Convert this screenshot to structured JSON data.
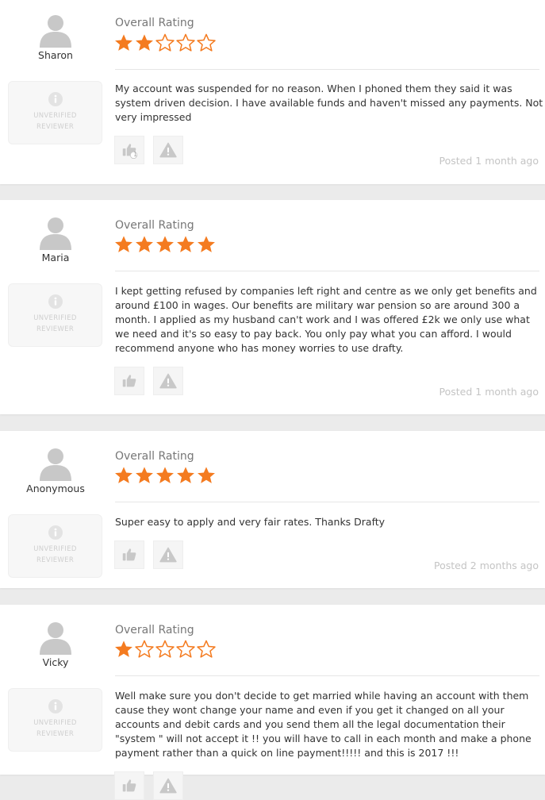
{
  "colors": {
    "star_filled": "#f47b20",
    "star_empty": "#f47b20",
    "avatar": "#c8c8c8",
    "muted_text": "#c4c4c4",
    "page_background": "#ebebeb"
  },
  "icons": {
    "avatar": "person-silhouette-icon",
    "unverified": "info-circle-icon",
    "helpful": "thumbs-up-icon",
    "report": "warning-triangle-icon",
    "star": "star-icon"
  },
  "reviews": [
    {
      "reviewer": "Sharon",
      "badge_text": "UNVERIFIED\nREVIEWER",
      "rating_label": "Overall Rating",
      "rating": 2,
      "max_rating": 5,
      "text": "My account was suspended for no reason. When I phoned them they said it was system driven decision. I have available funds and haven't missed any payments. Not very impressed",
      "helpful_count": "1",
      "posted": "Posted 1 month ago"
    },
    {
      "reviewer": "Maria",
      "badge_text": "UNVERIFIED\nREVIEWER",
      "rating_label": "Overall Rating",
      "rating": 5,
      "max_rating": 5,
      "text": "I kept getting refused by companies left right and centre as we only get benefits and around £100 in wages. Our benefits are military war pension so are around 300 a month. I applied as my husband can't work and I was offered £2k we only use what we need and it's so easy to pay back. You only pay what you can afford. I would recommend anyone who has money worries to use drafty.",
      "helpful_count": "",
      "posted": "Posted 1 month ago"
    },
    {
      "reviewer": "Anonymous",
      "badge_text": "UNVERIFIED\nREVIEWER",
      "rating_label": "Overall Rating",
      "rating": 5,
      "max_rating": 5,
      "text": "Super easy to apply and very fair rates. Thanks Drafty",
      "helpful_count": "",
      "posted": "Posted 2 months ago"
    },
    {
      "reviewer": "Vicky",
      "badge_text": "UNVERIFIED\nREVIEWER",
      "rating_label": "Overall Rating",
      "rating": 1,
      "max_rating": 5,
      "text": "Well make sure you don't decide to get married while having an account with them cause they wont change your name and even if you get it changed on all your accounts and debit cards and you send them all the legal documentation their \"system \" will not accept it !! you will have to call in each month and make a phone payment rather than a quick on line payment!!!!! and this is 2017 !!!",
      "helpful_count": "",
      "posted": ""
    }
  ]
}
